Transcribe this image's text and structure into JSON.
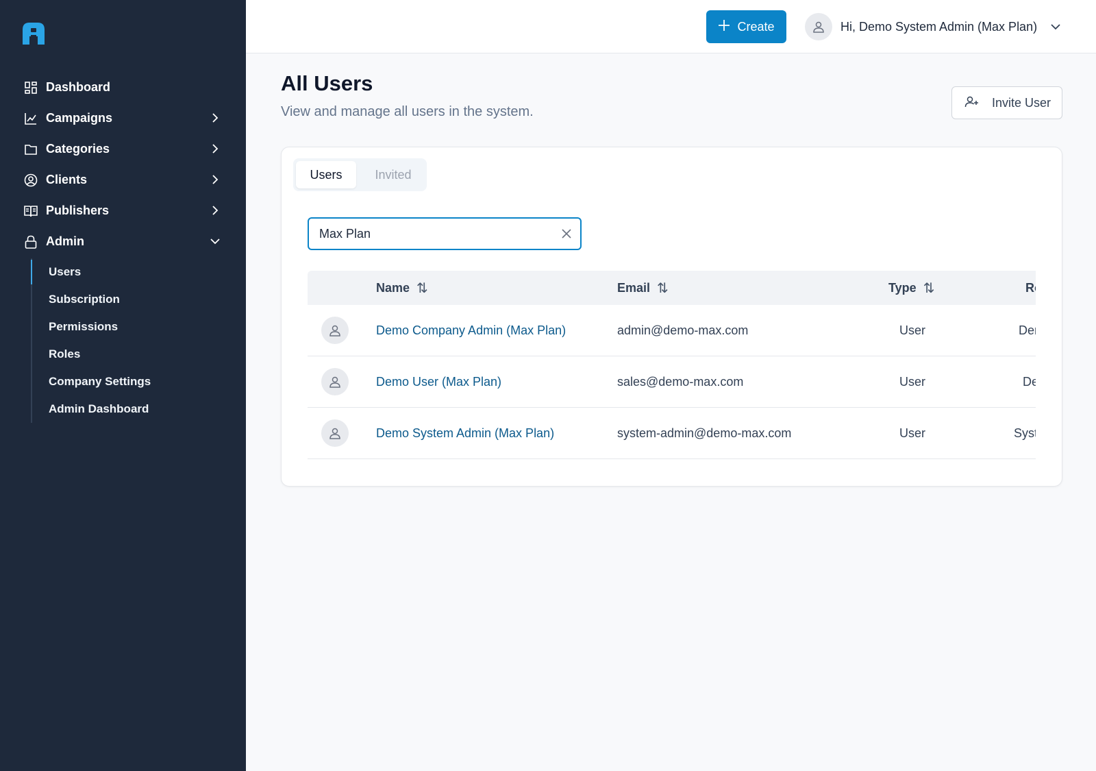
{
  "sidebar": {
    "logo": "app-logo",
    "items": [
      {
        "label": "Dashboard",
        "icon": "dashboard-icon"
      },
      {
        "label": "Campaigns",
        "icon": "chart-line-icon"
      },
      {
        "label": "Categories",
        "icon": "folder-icon"
      },
      {
        "label": "Clients",
        "icon": "user-circle-icon"
      },
      {
        "label": "Publishers",
        "icon": "book-open-icon"
      },
      {
        "label": "Admin",
        "icon": "lock-icon"
      }
    ],
    "admin_sub": [
      "Users",
      "Subscription",
      "Permissions",
      "Roles",
      "Company Settings",
      "Admin Dashboard"
    ]
  },
  "header": {
    "create_label": "Create",
    "greeting": "Hi, Demo System Admin (Max Plan)"
  },
  "main": {
    "title": "All Users",
    "subtitle": "View and manage all users in the system.",
    "invite_label": "Invite User",
    "tabs": [
      "Users",
      "Invited"
    ],
    "search_value": "Max Plan",
    "columns": [
      "Name",
      "Email",
      "Type",
      "Ro"
    ],
    "rows": [
      {
        "name": "Demo Company Admin (Max Plan)",
        "email": "admin@demo-max.com",
        "type": "User",
        "role": "Dem"
      },
      {
        "name": "Demo User (Max Plan)",
        "email": "sales@demo-max.com",
        "type": "User",
        "role": "Der"
      },
      {
        "name": "Demo System Admin (Max Plan)",
        "email": "system-admin@demo-max.com",
        "type": "User",
        "role": "Syste"
      }
    ]
  },
  "colors": {
    "sidebar_bg": "#1e293b",
    "accent": "#0b84c8",
    "link": "#0c5a8c"
  }
}
